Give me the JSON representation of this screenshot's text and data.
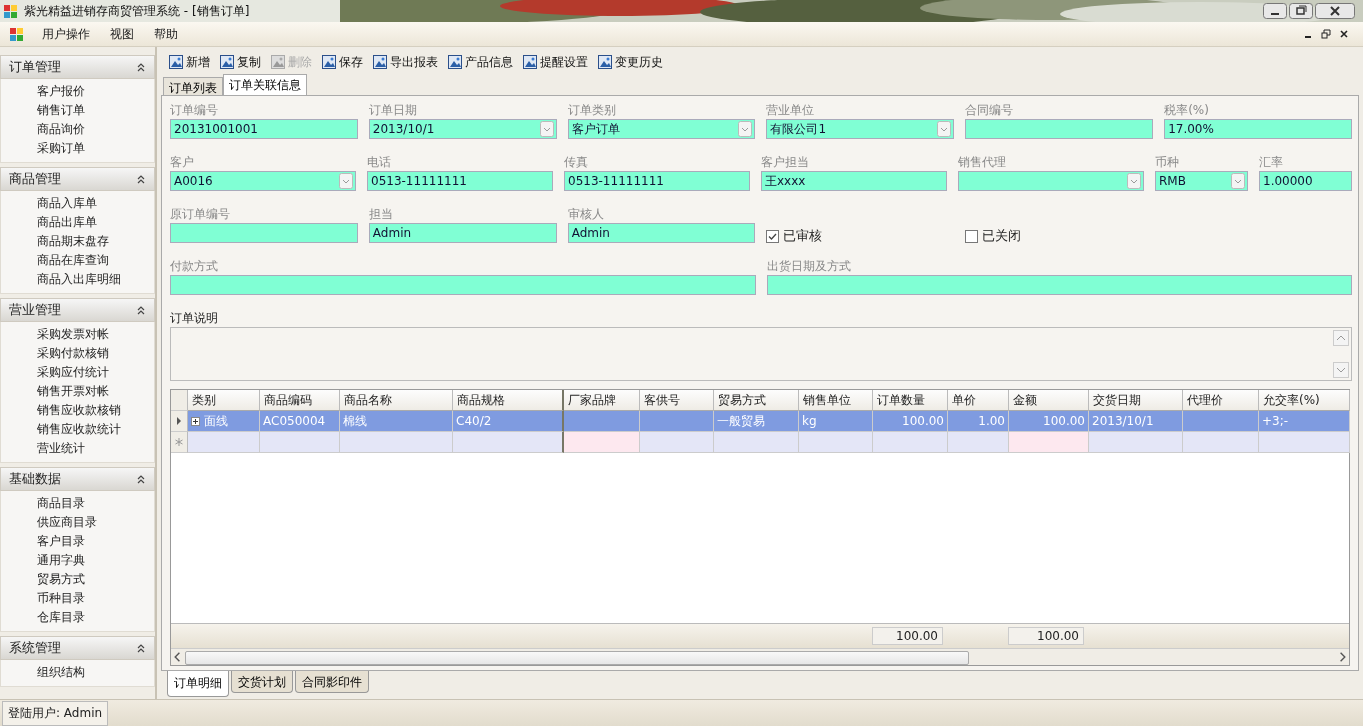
{
  "window": {
    "title": "紫光精益进销存商贸管理系统 - [销售订单]"
  },
  "menu": [
    "用户操作",
    "视图",
    "帮助"
  ],
  "sidebar": [
    {
      "title": "订单管理",
      "expanded": true,
      "items": [
        "客户报价",
        "销售订单",
        "商品询价",
        "采购订单"
      ]
    },
    {
      "title": "商品管理",
      "expanded": true,
      "items": [
        "商品入库单",
        "商品出库单",
        "商品期末盘存",
        "商品在库查询",
        "商品入出库明细"
      ]
    },
    {
      "title": "营业管理",
      "expanded": true,
      "items": [
        "采购发票对帐",
        "采购付款核销",
        "采购应付统计",
        "销售开票对帐",
        "销售应收款核销",
        "销售应收款统计",
        "营业统计"
      ]
    },
    {
      "title": "基础数据",
      "expanded": true,
      "items": [
        "商品目录",
        "供应商目录",
        "客户目录",
        "通用字典",
        "贸易方式",
        "币种目录",
        "仓库目录"
      ]
    },
    {
      "title": "系统管理",
      "expanded": true,
      "items": [
        "组织结构"
      ]
    }
  ],
  "toolbar": [
    {
      "label": "新增",
      "disabled": false
    },
    {
      "label": "复制",
      "disabled": false
    },
    {
      "label": "删除",
      "disabled": true
    },
    {
      "label": "保存",
      "disabled": false
    },
    {
      "label": "导出报表",
      "disabled": false
    },
    {
      "label": "产品信息",
      "disabled": false
    },
    {
      "label": "提醒设置",
      "disabled": false
    },
    {
      "label": "变更历史",
      "disabled": false
    }
  ],
  "tabs": [
    {
      "label": "订单列表",
      "selected": false
    },
    {
      "label": "订单关联信息",
      "selected": true
    }
  ],
  "form_rows": [
    [
      {
        "kind": "text",
        "label": "订单编号",
        "value": "20131001001"
      },
      {
        "kind": "combo",
        "label": "订单日期",
        "value": "2013/10/1"
      },
      {
        "kind": "combo",
        "label": "订单类别",
        "value": "客户订单"
      },
      {
        "kind": "combo",
        "label": "营业单位",
        "value": "有限公司1"
      },
      {
        "kind": "text",
        "label": "合同编号"
      },
      {
        "kind": "text",
        "label": "税率(%)",
        "value": "17.00%"
      }
    ],
    [
      {
        "kind": "combo",
        "label": "客户",
        "value": "A0016"
      },
      {
        "kind": "text",
        "label": "电话",
        "value": "0513-11111111"
      },
      {
        "kind": "text",
        "label": "传真",
        "value": "0513-11111111"
      },
      {
        "kind": "text",
        "label": "客户担当",
        "value": "王xxxx"
      },
      {
        "kind": "combo",
        "label": "销售代理"
      },
      {
        "kind": "combo",
        "label": "币种",
        "value": "RMB",
        "narrow": true
      },
      {
        "kind": "text",
        "label": "汇率",
        "value": "1.00000",
        "narrow": true
      }
    ],
    [
      {
        "kind": "text",
        "label": "原订单编号"
      },
      {
        "kind": "text",
        "label": "担当",
        "value": "Admin"
      },
      {
        "kind": "text",
        "label": "审核人",
        "value": "Admin"
      },
      {
        "kind": "checkbox",
        "label": "已审核",
        "checked": true
      },
      {
        "kind": "checkbox",
        "label": "已关闭",
        "checked": false
      }
    ],
    [
      {
        "kind": "wide",
        "label": "付款方式"
      },
      {
        "kind": "wide",
        "label": "出货日期及方式"
      }
    ]
  ],
  "note": {
    "label": "订单说明"
  },
  "table": {
    "columns": [
      {
        "label": "类别"
      },
      {
        "label": "商品编码"
      },
      {
        "label": "商品名称"
      },
      {
        "label": "商品规格"
      },
      {
        "label": "厂家品牌"
      },
      {
        "label": "客供号"
      },
      {
        "label": "贸易方式"
      },
      {
        "label": "销售单位"
      },
      {
        "label": "订单数量",
        "numeric": true,
        "total": "100.00"
      },
      {
        "label": "单价",
        "numeric": true
      },
      {
        "label": "金额",
        "numeric": true,
        "total": "100.00"
      },
      {
        "label": "交货日期"
      },
      {
        "label": "代理价"
      },
      {
        "label": "允交率(%)"
      }
    ],
    "rows": [
      {
        "selected": true,
        "cells": [
          "面线",
          "AC050004",
          "棉线",
          "C40/2",
          "",
          "",
          "一般贸易",
          "kg",
          "100.00",
          "1.00",
          "100.00",
          "2013/10/1",
          "",
          "+3;-"
        ]
      }
    ]
  },
  "bottom_tabs": [
    {
      "label": "订单明细",
      "selected": true
    },
    {
      "label": "交货计划",
      "selected": false
    },
    {
      "label": "合同影印件",
      "selected": false
    }
  ],
  "status_bar": "登陆用户: Admin"
}
